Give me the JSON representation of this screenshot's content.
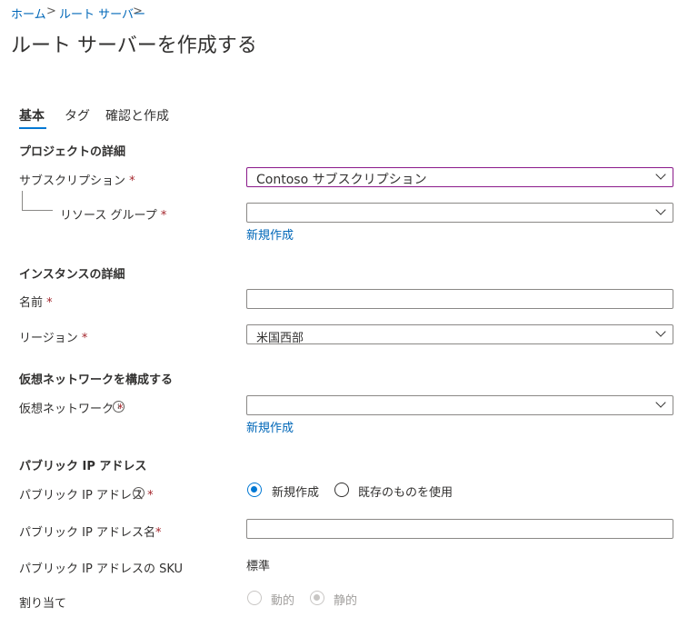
{
  "breadcrumb": {
    "home": "ホーム",
    "route_server": "ルート サーバー",
    "sep": ">"
  },
  "page": {
    "title": "ルート サーバーを作成する",
    "more": "···"
  },
  "tabs": [
    {
      "label": "基本"
    },
    {
      "label": "タグ"
    },
    {
      "label": "確認と作成"
    }
  ],
  "project": {
    "heading": "プロジェクトの詳細",
    "subscription_label": "サブスクリプション",
    "subscription_value": "Contoso サブスクリプション",
    "resource_group_label": "リソース グループ",
    "resource_group_value": "",
    "create_new": "新規作成"
  },
  "instance": {
    "heading": "インスタンスの詳細",
    "name_label": "名前",
    "name_value": "",
    "region_label": "リージョン",
    "region_value": "米国西部"
  },
  "vnet": {
    "heading": "仮想ネットワークを構成する",
    "vnet_label": "仮想ネットワーク",
    "vnet_value": "",
    "create_new": "新規作成"
  },
  "public_ip": {
    "heading": "パブリック IP アドレス",
    "ip_label": "パブリック IP アドレス",
    "option_new": "新規作成",
    "option_existing": "既存のものを使用",
    "ip_name_label": "パブリック IP アドレス名",
    "ip_name_value": "",
    "sku_label": "パブリック IP アドレスの SKU",
    "sku_value": "標準",
    "assignment_label": "割り当て",
    "assignment_dynamic": "動的",
    "assignment_static": "静的"
  },
  "required_mark": "*",
  "info_glyph": "i"
}
